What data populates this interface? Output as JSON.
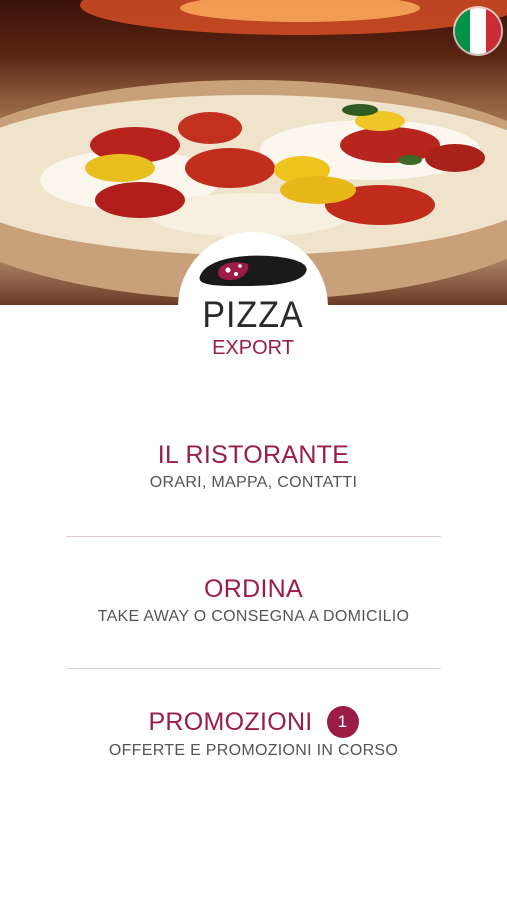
{
  "brand": {
    "logo_top": "PIZZA",
    "logo_bottom": "EXPORT"
  },
  "language": {
    "icon": "italy-flag-icon",
    "colors": [
      "#009246",
      "#ffffff",
      "#ce2b37"
    ]
  },
  "menu": [
    {
      "title": "IL RISTORANTE",
      "subtitle": "ORARI, MAPPA, CONTATTI"
    },
    {
      "title": "ORDINA",
      "subtitle": "TAKE AWAY O CONSEGNA A DOMICILIO"
    },
    {
      "title": "PROMOZIONI",
      "subtitle": "OFFERTE E PROMOZIONI IN CORSO",
      "badge": "1"
    }
  ],
  "colors": {
    "accent": "#9b1c45",
    "text_secondary": "#555555",
    "divider": "#e3c9d0"
  }
}
